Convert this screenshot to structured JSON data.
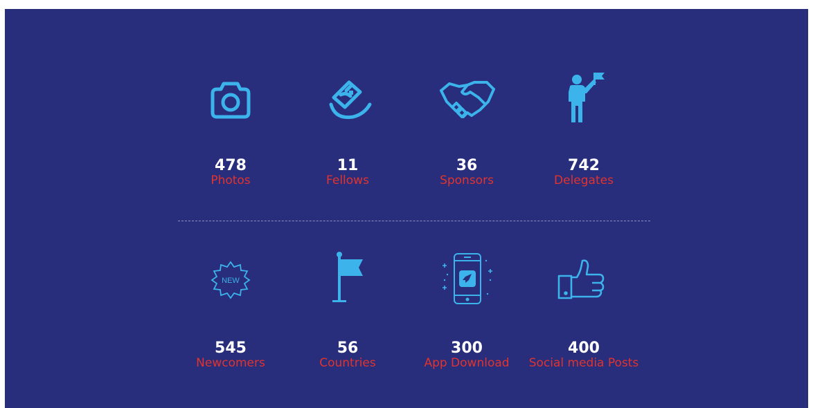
{
  "colors": {
    "background": "#282d7c",
    "icon": "#3cb3ea",
    "number": "#ffffff",
    "label": "#e0342f",
    "divider": "#8d8fc6"
  },
  "row1": [
    {
      "icon": "camera-icon",
      "value": "478",
      "label": "Photos"
    },
    {
      "icon": "graduation-cap-icon",
      "value": "11",
      "label": "Fellows"
    },
    {
      "icon": "handshake-icon",
      "value": "36",
      "label": "Sponsors"
    },
    {
      "icon": "person-with-flag-icon",
      "value": "742",
      "label": "Delegates"
    }
  ],
  "row2": [
    {
      "icon": "new-badge-icon",
      "badge_text": "NEW",
      "value": "545",
      "label": "Newcomers"
    },
    {
      "icon": "flag-icon",
      "value": "56",
      "label": "Countries"
    },
    {
      "icon": "smartphone-rocket-icon",
      "value": "300",
      "label": "App Download"
    },
    {
      "icon": "thumbs-up-icon",
      "value": "400",
      "label": "Social media Posts"
    }
  ]
}
